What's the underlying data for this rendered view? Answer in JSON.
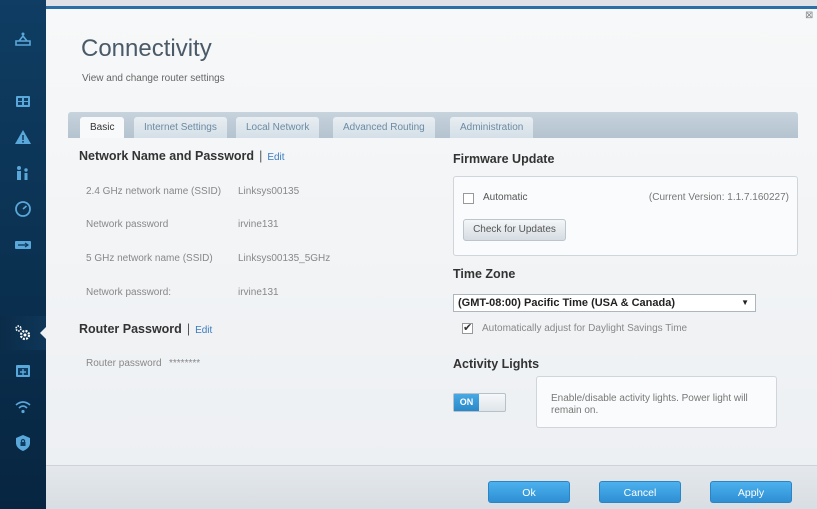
{
  "page": {
    "title": "Connectivity",
    "subtitle": "View and change router settings",
    "close_glyph": "⊠"
  },
  "sidebar": {
    "items": [
      {
        "icon": "router-icon"
      },
      {
        "icon": "devices-icon"
      },
      {
        "icon": "warning-icon"
      },
      {
        "icon": "parental-controls-icon"
      },
      {
        "icon": "speed-icon"
      },
      {
        "icon": "usb-icon"
      },
      {
        "icon": "gears-icon",
        "active": true
      },
      {
        "icon": "troubleshooting-icon"
      },
      {
        "icon": "wireless-icon"
      },
      {
        "icon": "security-icon"
      }
    ],
    "icon_color": "#5aa7d9"
  },
  "tabs": [
    "Basic",
    "Internet Settings",
    "Local Network",
    "Advanced Routing",
    "Administration"
  ],
  "network": {
    "heading": "Network Name and Password",
    "sep": "|",
    "edit": "Edit",
    "rows": [
      {
        "label": "2.4 GHz network name (SSID)",
        "value": "Linksys00135"
      },
      {
        "label": "Network password",
        "value": "irvine131"
      },
      {
        "label": "5 GHz network name (SSID)",
        "value": "Linksys00135_5GHz"
      },
      {
        "label": "Network password:",
        "value": "irvine131"
      }
    ]
  },
  "router_password": {
    "heading": "Router Password",
    "sep": "|",
    "edit": "Edit",
    "label": "Router password",
    "value": "********"
  },
  "firmware": {
    "heading": "Firmware Update",
    "automatic_label": "Automatic",
    "automatic_checked": false,
    "current_version": "(Current Version: 1.1.7.160227)",
    "check_button": "Check for Updates"
  },
  "timezone": {
    "heading": "Time Zone",
    "selected": "(GMT-08:00) Pacific Time (USA & Canada)",
    "arrow": "▼",
    "dst_label": "Automatically adjust for Daylight Savings Time",
    "dst_checked": true
  },
  "activity_lights": {
    "heading": "Activity Lights",
    "toggle_label": "ON",
    "description": "Enable/disable activity lights. Power light will remain on."
  },
  "footer": {
    "ok": "Ok",
    "cancel": "Cancel",
    "apply": "Apply"
  },
  "colors": {
    "accent": "#2e8fd3",
    "sidebar": "#0f3d63",
    "link": "#3b7bbf"
  }
}
